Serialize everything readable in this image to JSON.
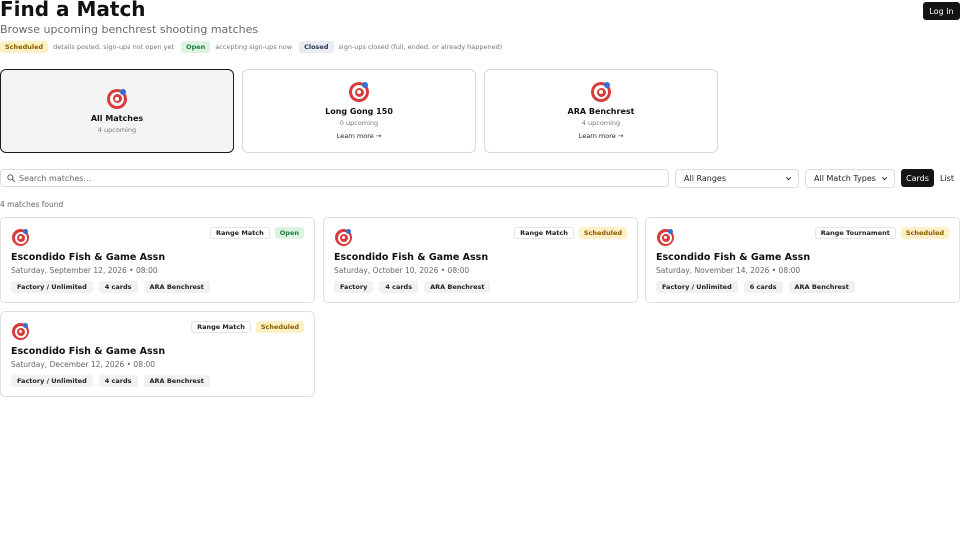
{
  "header": {
    "title": "Find a Match",
    "subtitle": "Browse upcoming benchrest shooting matches",
    "login_label": "Log In"
  },
  "legend": [
    {
      "label": "Scheduled",
      "status": "scheduled",
      "desc": "details posted, sign-ups not open yet"
    },
    {
      "label": "Open",
      "status": "open",
      "desc": "accepting sign-ups now"
    },
    {
      "label": "Closed",
      "status": "closed",
      "desc": "sign-ups closed (full, ended, or already happened)"
    }
  ],
  "match_types": [
    {
      "name": "All Matches",
      "count": "4 upcoming",
      "link": "",
      "icon": "target-icon",
      "selected": true
    },
    {
      "name": "Long Gong 150",
      "count": "0 upcoming",
      "link": "Learn more →",
      "icon": "target-icon",
      "selected": false
    },
    {
      "name": "ARA Benchrest",
      "count": "4 upcoming",
      "link": "Learn more →",
      "icon": "target-icon",
      "selected": false
    }
  ],
  "filters": {
    "search_placeholder": "Search matches...",
    "search_value": "",
    "range_select": "All Ranges",
    "type_select": "All Match Types"
  },
  "view_toggle": {
    "cards": "Cards",
    "list": "List",
    "active": "cards"
  },
  "results_count": "4 matches found",
  "matches": [
    {
      "type": "Range Match",
      "status": "Open",
      "status_key": "open",
      "name": "Escondido Fish & Game Assn",
      "date": "Saturday, September 12, 2026 • 08:00",
      "chips": [
        "Factory / Unlimited",
        "4 cards",
        "ARA Benchrest"
      ]
    },
    {
      "type": "Range Match",
      "status": "Scheduled",
      "status_key": "scheduled",
      "name": "Escondido Fish & Game Assn",
      "date": "Saturday, October 10, 2026 • 08:00",
      "chips": [
        "Factory",
        "4 cards",
        "ARA Benchrest"
      ]
    },
    {
      "type": "Range Tournament",
      "status": "Scheduled",
      "status_key": "scheduled",
      "name": "Escondido Fish & Game Assn",
      "date": "Saturday, November 14, 2026 • 08:00",
      "chips": [
        "Factory / Unlimited",
        "6 cards",
        "ARA Benchrest"
      ]
    },
    {
      "type": "Range Match",
      "status": "Scheduled",
      "status_key": "scheduled",
      "name": "Escondido Fish & Game Assn",
      "date": "Saturday, December 12, 2026 • 08:00",
      "chips": [
        "Factory / Unlimited",
        "4 cards",
        "ARA Benchrest"
      ]
    }
  ],
  "colors": {
    "scheduled_bg": "#fdf0c4",
    "open_bg": "#dcf3e2",
    "closed_bg": "#e9edf3",
    "primary": "#141414",
    "target_red": "#d93a3a",
    "target_dart": "#2f6fd6"
  }
}
